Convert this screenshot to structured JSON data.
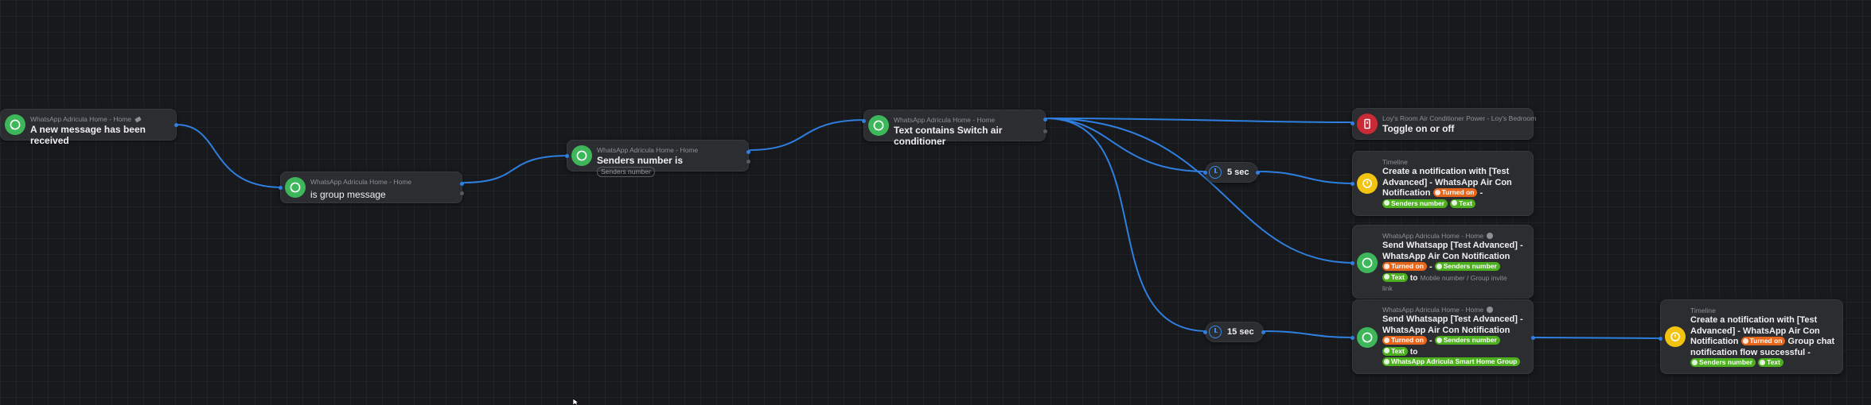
{
  "nodes": {
    "trigger": {
      "sub": "WhatsApp Adricula Home - Home",
      "title": "A new message has been received"
    },
    "group_check": {
      "sub": "WhatsApp Adricula Home - Home",
      "title": "is group message"
    },
    "senders": {
      "sub": "WhatsApp Adricula Home - Home",
      "title": "Senders number is",
      "placeholder": "Senders number"
    },
    "contains": {
      "sub": "WhatsApp Adricula Home - Home",
      "title": "Text contains Switch air conditioner"
    },
    "aircon": {
      "sub": "Loy's Room Air Conditioner Power - Loy's Bedroom",
      "title": "Toggle on or off"
    },
    "timeline1": {
      "sub": "Timeline",
      "l1": "Create a notification with [Test",
      "l2": "Advanced] - WhatsApp Air Con",
      "l3": "Notification",
      "turned_on": "Turned on",
      "dash": "-",
      "senders_number": "Senders number",
      "text": "Text"
    },
    "send1": {
      "sub": "WhatsApp Adricula Home - Home",
      "l1": "Send Whatsapp [Test Advanced] -",
      "l2": "WhatsApp Air Con Notification",
      "turned_on": "Turned on",
      "dash": "-",
      "senders_number": "Senders number",
      "text": "Text",
      "to": "to",
      "placeholder_a": "Mobile number / Group invite",
      "placeholder_b": "link"
    },
    "send2": {
      "sub": "WhatsApp Adricula Home - Home",
      "l1": "Send Whatsapp [Test Advanced] -",
      "l2": "WhatsApp Air Con Notification",
      "turned_on": "Turned on",
      "dash": "-",
      "senders_number": "Senders number",
      "text": "Text",
      "to": "to",
      "group": "WhatsApp Adricula Smart Home Group"
    },
    "timeline2": {
      "sub": "Timeline",
      "l1": "Create a notification with [Test",
      "l2": "Advanced] - WhatsApp Air Con",
      "l3": "Notification",
      "turned_on": "Turned on",
      "l3b": "Group chat",
      "l4": "notification flow successful -",
      "senders_number": "Senders number",
      "text": "Text"
    }
  },
  "delays": {
    "d5": "5 sec",
    "d15": "15 sec"
  },
  "colors": {
    "background": "#17191c",
    "card": "#2b2d31",
    "wire": "#2f7fe0",
    "whatsapp": "#3db75a",
    "token_green": "#4caf1e",
    "token_orange": "#e8661c",
    "timeline_yellow": "#f2c40f",
    "device_red": "#c92a35"
  },
  "icons": {
    "whatsapp": "whatsapp-icon",
    "timeline": "timeline-icon",
    "device": "air-conditioner-icon",
    "delay": "clock-icon",
    "info": "info-icon",
    "tag": "tag-icon"
  }
}
